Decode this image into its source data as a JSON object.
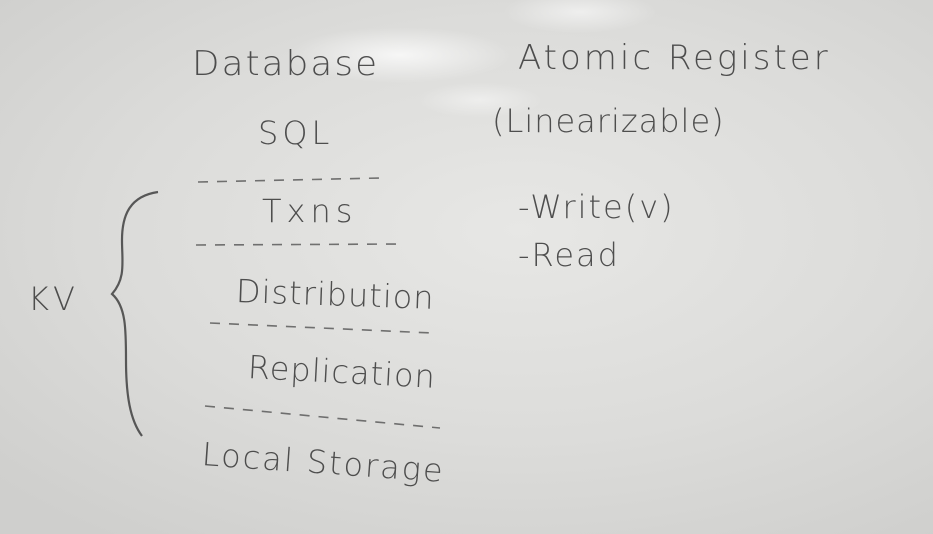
{
  "whiteboard": {
    "left_column": {
      "heading": "Database",
      "sql": "SQL",
      "layers": [
        "Txns",
        "Distribution",
        "Replication",
        "Local Storage"
      ]
    },
    "brace_label": "KV",
    "right_column": {
      "heading": "Atomic Register",
      "subheading": "(Linearizable)",
      "operations": [
        "-Write(v)",
        "-Read"
      ]
    }
  }
}
